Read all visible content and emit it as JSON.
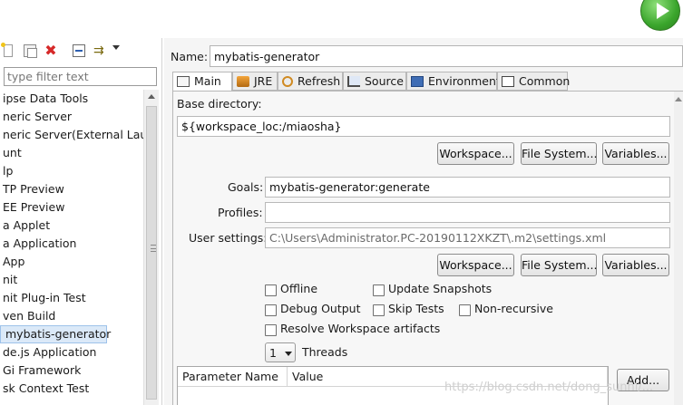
{
  "filter": {
    "placeholder": "type filter text"
  },
  "tree": {
    "items": [
      {
        "label": "ipse Data Tools"
      },
      {
        "label": "neric Server"
      },
      {
        "label": "neric Server(External Launc"
      },
      {
        "label": "unt"
      },
      {
        "label": "lp"
      },
      {
        "label": "TP Preview"
      },
      {
        "label": "EE Preview"
      },
      {
        "label": "a Applet"
      },
      {
        "label": "a Application"
      },
      {
        "label": "App"
      },
      {
        "label": "nit"
      },
      {
        "label": "nit Plug-in Test"
      },
      {
        "label": "ven Build"
      },
      {
        "label": "mybatis-generator"
      },
      {
        "label": "de.js Application"
      },
      {
        "label": "Gi Framework"
      },
      {
        "label": "sk Context Test"
      }
    ]
  },
  "config": {
    "name_label": "Name:",
    "name_value": "mybatis-generator",
    "tabs": [
      {
        "label": "Main"
      },
      {
        "label": "JRE"
      },
      {
        "label": "Refresh"
      },
      {
        "label": "Source"
      },
      {
        "label": "Environment"
      },
      {
        "label": "Common"
      }
    ],
    "base_directory_label": "Base directory:",
    "base_directory_value": "${workspace_loc:/miaosha}",
    "buttons": {
      "workspace": "Workspace...",
      "file_system": "File System...",
      "variables": "Variables...",
      "add": "Add..."
    },
    "goals_label": "Goals:",
    "goals_value": "mybatis-generator:generate",
    "profiles_label": "Profiles:",
    "profiles_value": "",
    "user_settings_label": "User settings:",
    "user_settings_value": "C:\\Users\\Administrator.PC-20190112XKZT\\.m2\\settings.xml",
    "checkboxes": {
      "offline": "Offline",
      "update_snapshots": "Update Snapshots",
      "debug_output": "Debug Output",
      "skip_tests": "Skip Tests",
      "non_recursive": "Non-recursive",
      "resolve_workspace": "Resolve Workspace artifacts"
    },
    "threads_value": "1",
    "threads_label": "Threads",
    "table": {
      "col_param": "Parameter Name",
      "col_value": "Value"
    }
  },
  "watermark": "https://blog.csdn.net/dong_sunhl/..."
}
